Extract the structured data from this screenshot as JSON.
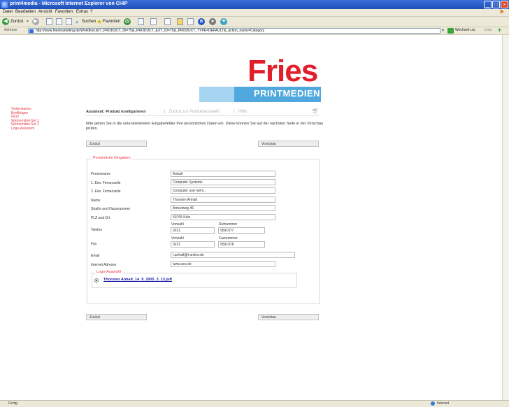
{
  "window": {
    "title": "print4media - Microsoft Internet Explorer von CHIP",
    "minimize": "_",
    "maximize": "□",
    "close": "×"
  },
  "menu": [
    "Datei",
    "Bearbeiten",
    "Ansicht",
    "Favoriten",
    "Extras",
    "?"
  ],
  "toolbar": {
    "back_label": "Zurück",
    "search_label": "Suchen",
    "favorites_label": "Favoriten"
  },
  "address": {
    "label": "Adresse",
    "url": "http://www.friesmarketing.de/Workflow.do?_PRODUCT_ID=75&_PRODUCT_EXT_ID=75&_PRODUCT_TYPE=DEFAULT&_action_name=Category",
    "go_label": "Wechseln zu",
    "links_label": "Links"
  },
  "status": {
    "left": "Fertig",
    "right": "Internet"
  },
  "logo": {
    "brand": "Fries",
    "subtitle": "PRINTMEDIEN"
  },
  "sidebar": [
    "Visitenkarten",
    "Briefbögen",
    "Flyer",
    "Werbemittel-Set 1",
    "Werbemittel-Set 2",
    "Logo-Assistent"
  ],
  "wizard": {
    "current": "Assistent: Produkt konfigurieren",
    "back_link": "Zurück zur Produktauswahl",
    "help_link": "Hilfe",
    "separator": "|"
  },
  "intro": "bitte geben Sie in die untenstehenden Eingabefelder Ihre persönlichen Daten ein. Diese können Sie auf der nächsten Seite in der Vorschau prüfen.",
  "buttons": {
    "back": "Zurück",
    "preview": "Vorschau"
  },
  "form": {
    "legend": "Persönliche Eingaben",
    "fields": [
      {
        "label": "Firmenname",
        "value": "Anhalt"
      },
      {
        "label": "1. Erw. Firmenzeile",
        "value": "Computer Systems"
      },
      {
        "label": "2. Erw. Firmenzeile",
        "value": "Computer und mehr..."
      },
      {
        "label": "Name",
        "value": "Thorsten Anhalt"
      },
      {
        "label": "Straße und Hausnummer",
        "value": "Amselweg 46"
      },
      {
        "label": "PLZ und Ort",
        "value": "50765 Köln"
      }
    ],
    "telefon": {
      "label": "Telefon",
      "area_label": "Vorwahl",
      "area_value": "0221",
      "number_label": "Rufnummer",
      "number_value": "9591977"
    },
    "fax": {
      "label": "Fax",
      "area_label": "Vorwahl",
      "area_value": "0221",
      "number_label": "Faxnummer",
      "number_value": "9591978"
    },
    "email": {
      "label": "Email",
      "value": "t.anhalt@t-online.de"
    },
    "web": {
      "label": "Internet Adresse",
      "value": "www.acs.de"
    },
    "logo": {
      "legend": "Logo-Auswahl",
      "file": "Thorsten Anhalt_14_9_2005_3_13.pdf"
    }
  }
}
